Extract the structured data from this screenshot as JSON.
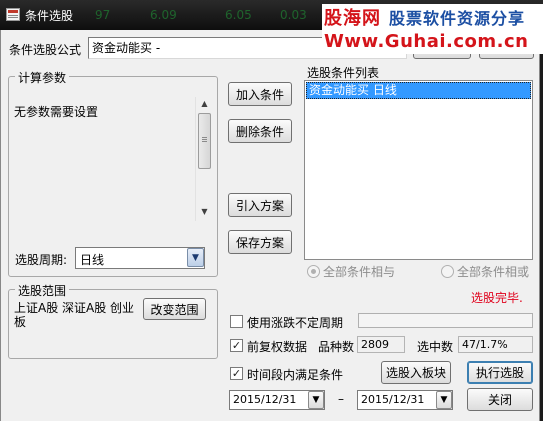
{
  "window": {
    "title": "条件选股",
    "ghost_numbers": [
      "97",
      "6.09",
      "6.05",
      "0.03"
    ]
  },
  "watermark": {
    "brand": "股海网",
    "tagline": "股票软件资源分享",
    "url": "Www.Guhai.com.cn"
  },
  "formula": {
    "label": "条件选股公式",
    "value": "资金动能买    -"
  },
  "params": {
    "group_title": "计算参数",
    "message": "无参数需要设置",
    "period_label": "选股周期:",
    "period_value": "日线"
  },
  "actions": {
    "add_condition": "加入条件",
    "delete_condition": "删除条件",
    "import_plan": "引入方案",
    "save_plan": "保存方案"
  },
  "conditions": {
    "list_label": "选股条件列表",
    "items": [
      "资金动能买    日线"
    ],
    "radio_and": "全部条件相与",
    "radio_or": "全部条件相或"
  },
  "status": {
    "text": "选股完毕."
  },
  "range": {
    "group_title": "选股范围",
    "value": "上证A股 深证A股 创业板",
    "change_button": "改变范围"
  },
  "options": {
    "use_variable_period": "使用涨跌不定周期",
    "use_adjusted": "前复权数据",
    "count_label": "品种数",
    "count_value": "2809",
    "selected_label": "选中数",
    "selected_value": "47/1.7%",
    "time_range": "时间段内满足条件",
    "start_date": "2015/12/31",
    "dash": "–",
    "end_date": "2015/12/31"
  },
  "buttons": {
    "select_to_block": "选股入板块",
    "run": "执行选股",
    "close": "关闭"
  },
  "colors": {
    "selection": "#3399ff",
    "status_red": "#e0001b",
    "watermark_red": "#d4141a",
    "watermark_blue": "#1c4fa3"
  }
}
